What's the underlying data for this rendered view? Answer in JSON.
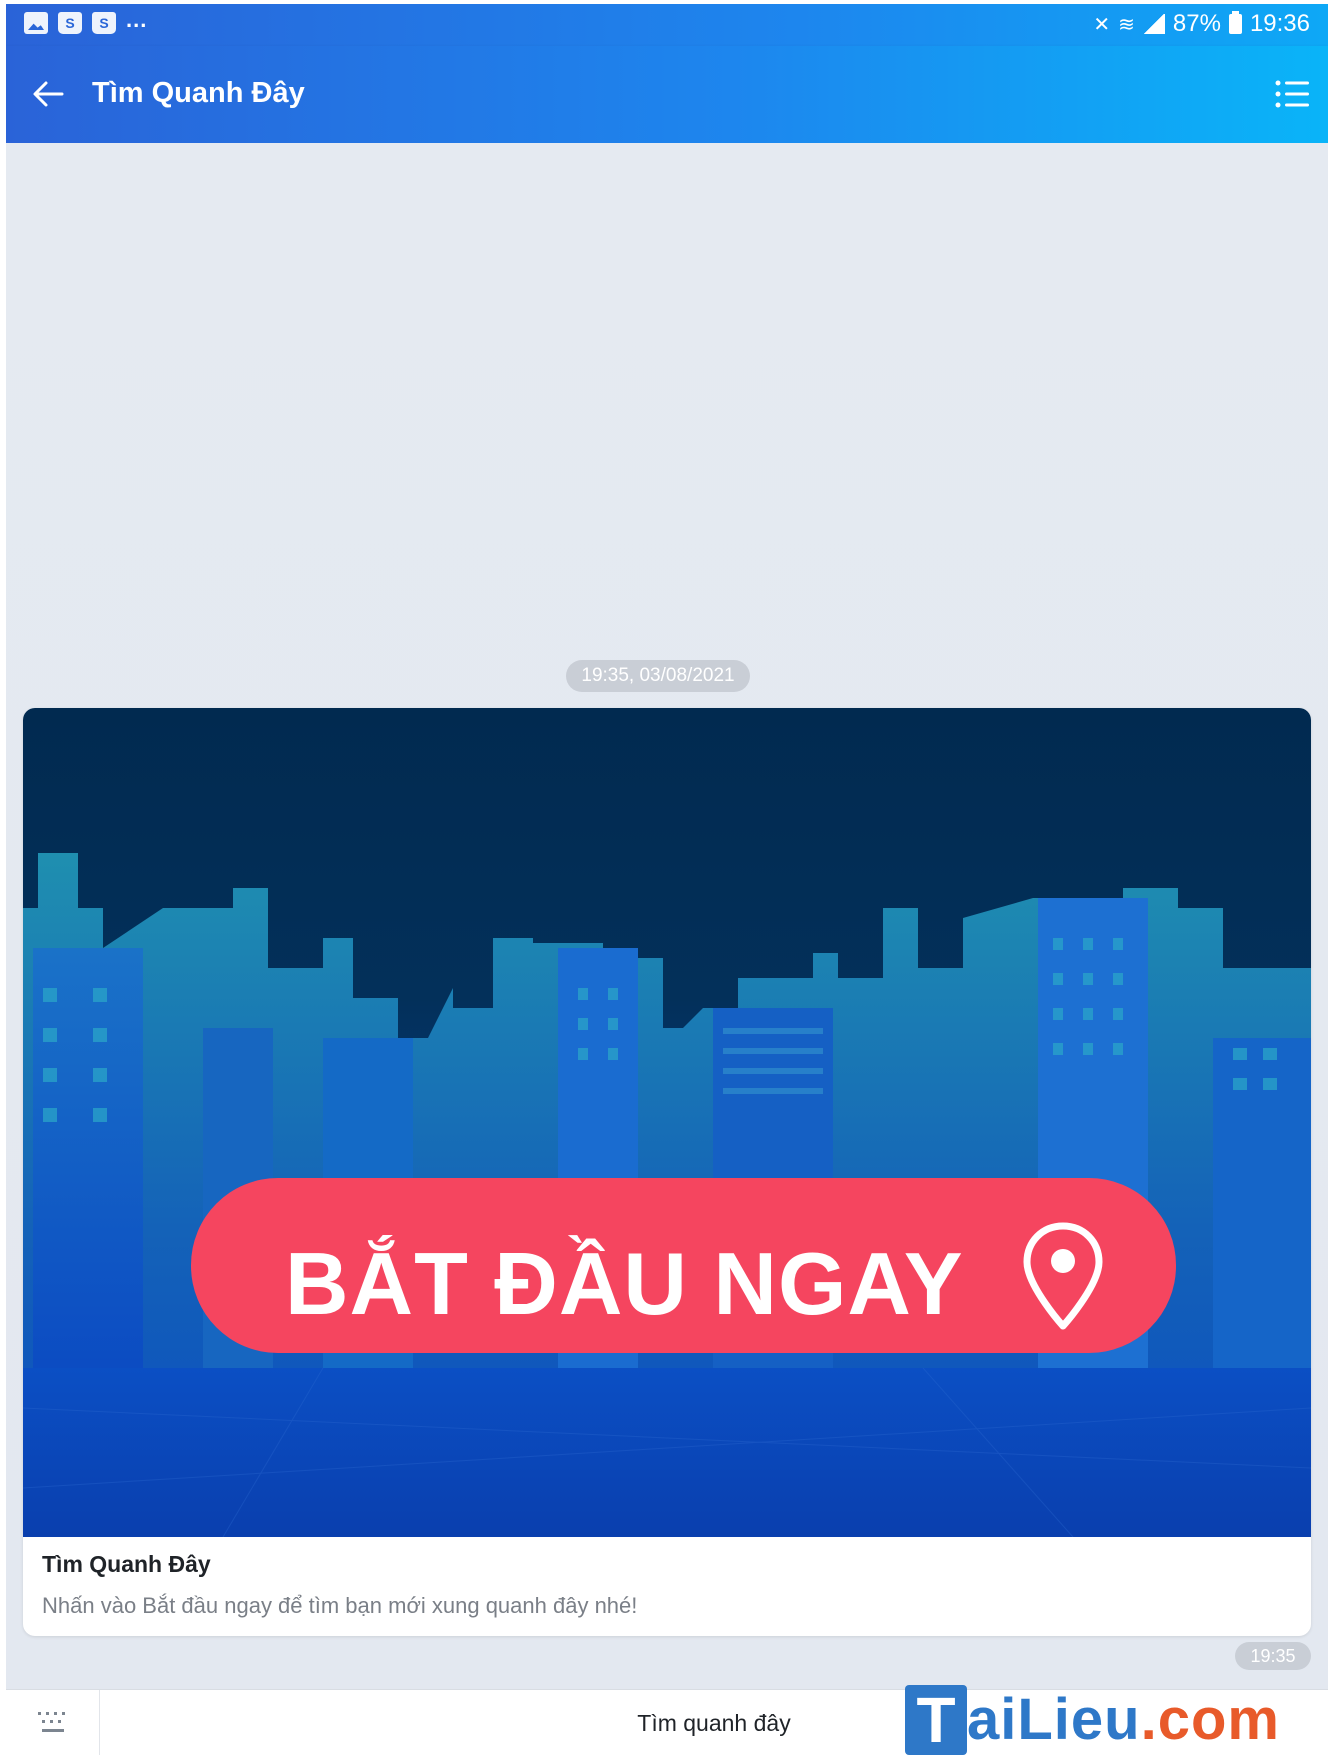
{
  "status_bar": {
    "battery": "87%",
    "time": "19:36",
    "more": "..."
  },
  "app_bar": {
    "title": "Tìm Quanh Đây"
  },
  "chat": {
    "date_stamp": "19:35, 03/08/2021",
    "card": {
      "banner_text": "BẮT ĐẦU NGAY",
      "title": "Tìm Quanh Đây",
      "description": "Nhấn vào Bắt đầu ngay để tìm bạn mới xung quanh đây nhé!"
    },
    "message_time": "19:35"
  },
  "bottom_bar": {
    "quick_action": "Tìm quanh đây"
  },
  "watermark": {
    "first": "T",
    "middle": "aiLieu",
    "suffix": ".com"
  },
  "colors": {
    "header_start": "#2a63d8",
    "header_end": "#0ab4f8",
    "cta": "#f5455f",
    "banner_top": "#002a52",
    "banner_bottom": "#0a4fc0"
  }
}
